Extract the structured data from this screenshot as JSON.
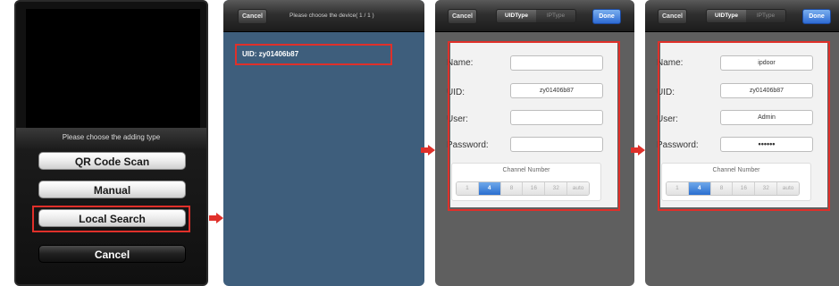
{
  "screen1": {
    "sheet_title": "Please choose the adding type",
    "buttons": [
      "QR Code Scan",
      "Manual",
      "Local Search",
      "Cancel"
    ]
  },
  "screen2": {
    "cancel_label": "Cancel",
    "title": "Please choose the device( 1 / 1 )",
    "device_row": "UID: zy01406b87"
  },
  "screen3": {
    "cancel_label": "Cancel",
    "segment": [
      "UIDType",
      "IPType"
    ],
    "done_label": "Done",
    "labels": [
      "Name:",
      "UID:",
      "User:",
      "Password:"
    ],
    "values": [
      "",
      "zy01406b87",
      "",
      ""
    ],
    "channel_title": "Channel Number",
    "channels": [
      "1",
      "4",
      "8",
      "16",
      "32",
      "auto"
    ],
    "selected_channel": "4"
  },
  "screen4": {
    "cancel_label": "Cancel",
    "segment": [
      "UIDType",
      "IPType"
    ],
    "done_label": "Done",
    "labels": [
      "Name:",
      "UID:",
      "User:",
      "Password:"
    ],
    "values": [
      "ipdoor",
      "zy01406b87",
      "Admin",
      "••••••"
    ],
    "channel_title": "Channel Number",
    "channels": [
      "1",
      "4",
      "8",
      "16",
      "32",
      "auto"
    ],
    "selected_channel": "4"
  },
  "colors": {
    "highlight": "#e0302a",
    "arrow": "#e0302a",
    "accent": "#2b6fd0"
  }
}
